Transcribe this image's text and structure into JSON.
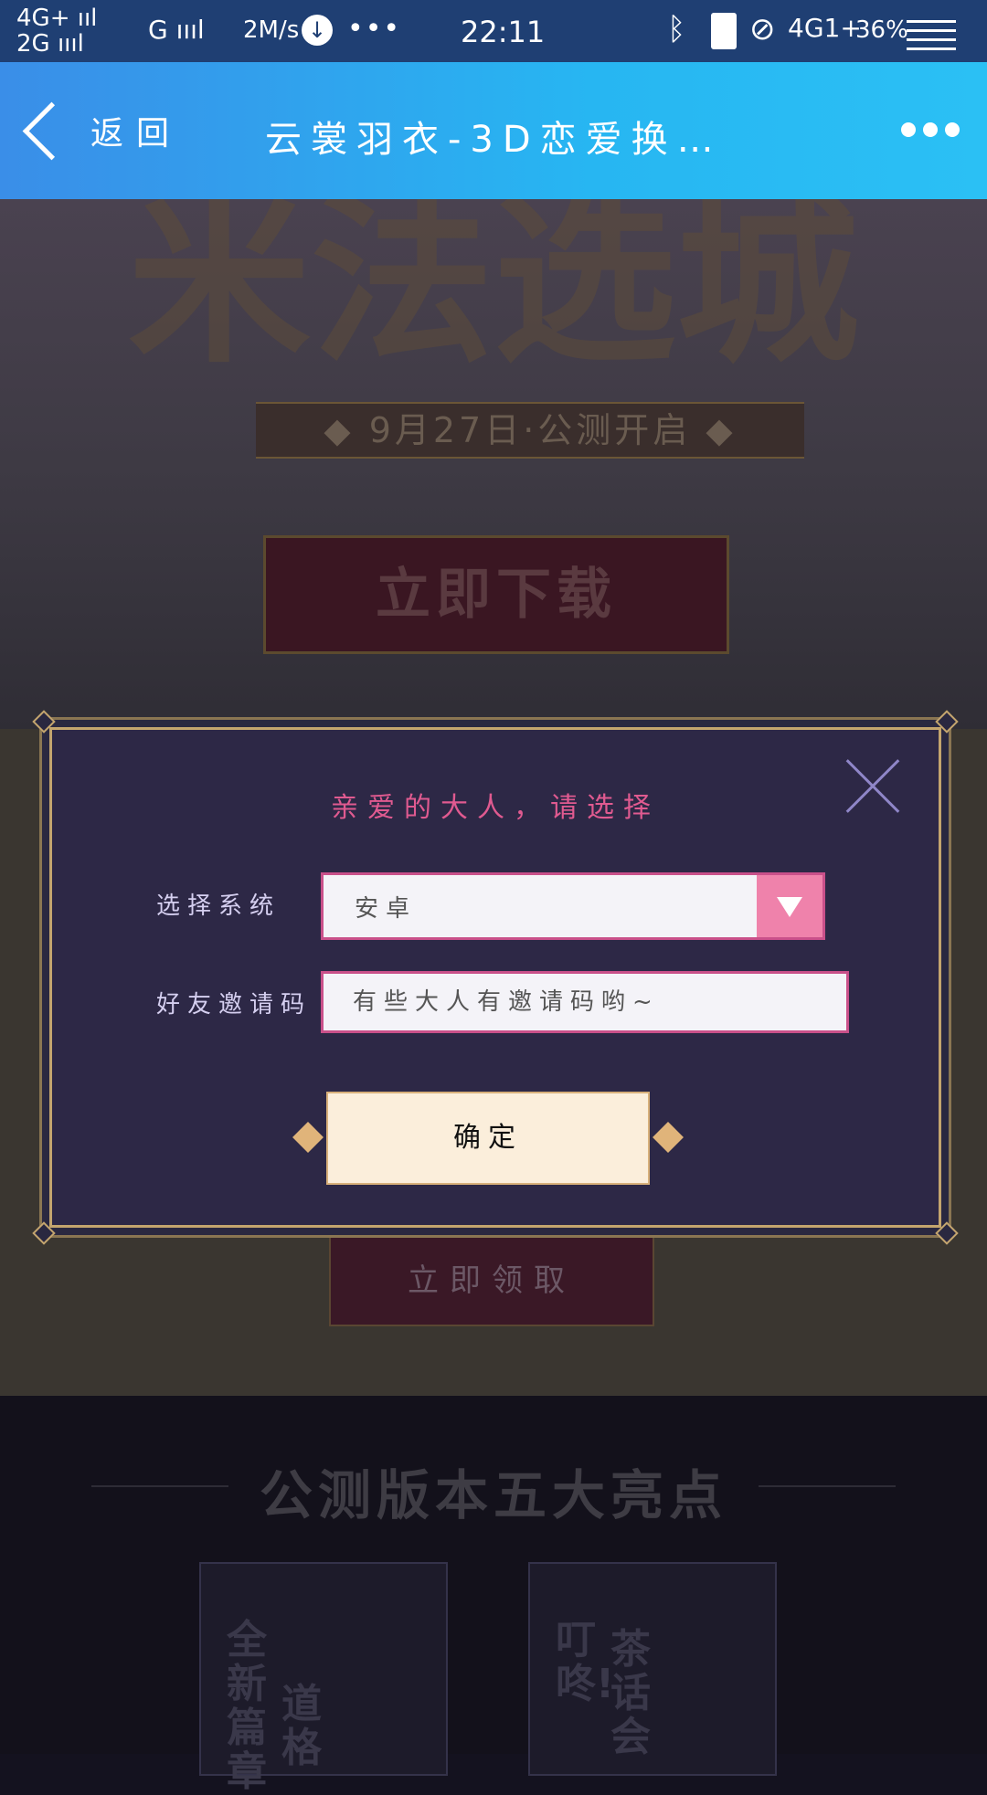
{
  "status_bar": {
    "network_left": "4G+ ııl\n2G ıııl",
    "network_g": "G ıııl",
    "speed": "2M/s",
    "more_dots": "•••",
    "time": "22:11",
    "network_right": "4G1+",
    "battery_percent": "36%"
  },
  "nav": {
    "back_label": "返回",
    "title": "云裳羽衣-3D恋爱换…"
  },
  "background": {
    "banner_art_text": "米法选城",
    "date_ribbon": "◆ 9月27日·公测开启 ◆",
    "download_button": "立即下载",
    "claim_button": "立即领取",
    "section_title": "公测版本五大亮点",
    "card1_text": "全新篇章",
    "card1_side": "道格",
    "card2_text": "叮咚!",
    "card2_side": "茶话会"
  },
  "modal": {
    "title": "亲爱的大人，请选择",
    "system_label": "选择系统",
    "system_value": "安卓",
    "invite_label": "好友邀请码",
    "invite_placeholder": "有些大人有邀请码哟~",
    "invite_value": "",
    "confirm_label": "确定"
  }
}
